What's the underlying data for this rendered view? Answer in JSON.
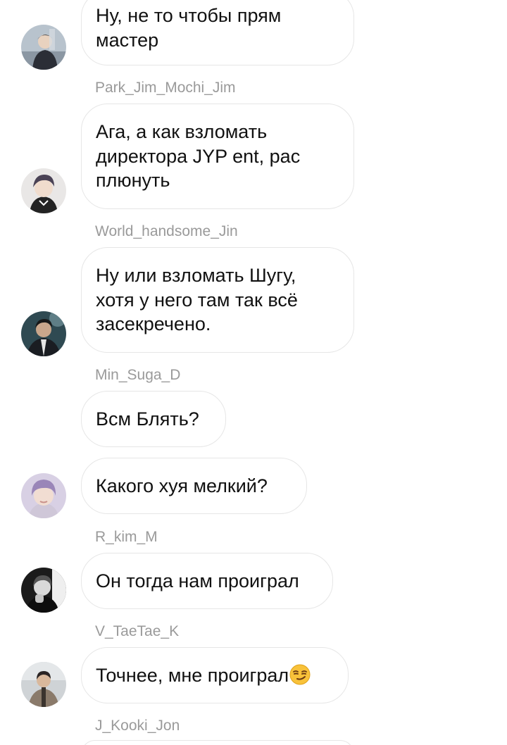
{
  "messages": [
    {
      "lines": [
        "Ну, не то чтобы прям",
        "мастер"
      ],
      "sender": "Park_Jim_Mochi_Jim"
    },
    {
      "lines": [
        "Ага, а как взломать",
        "директора JYP ent, рас",
        "плюнуть"
      ],
      "sender": "World_handsome_Jin"
    },
    {
      "lines": [
        "Ну или взломать Шугу,",
        "хотя у него там так всё",
        "засекречено."
      ],
      "sender": "Min_Suga_D"
    },
    {
      "lines": [
        "Всм Блять?"
      ]
    },
    {
      "lines": [
        "Какого хуя мелкий?"
      ],
      "sender": "R_kim_M"
    },
    {
      "lines": [
        "Он тогда нам проиграл"
      ],
      "sender": "V_TaeTae_K"
    },
    {
      "lines": [
        "Точнее, мне проиграл"
      ],
      "emoji": "smirking-face",
      "sender": "J_Kooki_Jon"
    }
  ],
  "avatars": [
    {
      "icon": "user-avatar-photo"
    },
    {
      "icon": "user-avatar-photo"
    },
    {
      "icon": "user-avatar-photo"
    },
    {
      "icon": "user-avatar-photo"
    },
    {
      "icon": "user-avatar-photo"
    },
    {
      "icon": "user-avatar-photo"
    }
  ],
  "colors": {
    "background": "#ffffff",
    "bubble_border": "#e6e6e6",
    "message_text": "#111111",
    "sender_text": "#9a9a9a"
  }
}
